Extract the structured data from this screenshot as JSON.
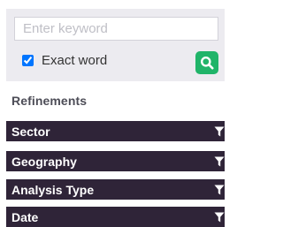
{
  "search": {
    "placeholder": "Enter keyword",
    "value": "",
    "exact_word_label": "Exact word",
    "exact_word_checked": true,
    "button_icon": "search-icon"
  },
  "refinements": {
    "title": "Refinements",
    "facets": [
      {
        "label": "Sector",
        "icon": "filter-icon"
      },
      {
        "label": "Geography",
        "icon": "filter-icon"
      },
      {
        "label": "Analysis Type",
        "icon": "filter-icon"
      },
      {
        "label": "Date",
        "icon": "filter-icon"
      }
    ]
  },
  "colors": {
    "panel_bg": "#ecebf0",
    "facet_bg": "#2f2438",
    "search_button": "#20b469",
    "refinements_title": "#4d4d57"
  }
}
